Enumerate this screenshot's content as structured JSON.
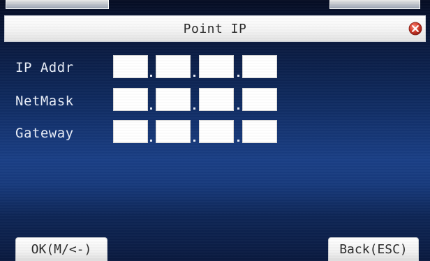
{
  "window": {
    "title": "Point IP",
    "close_icon": "close-icon",
    "accent_close": "#d23a2a"
  },
  "form": {
    "rows": [
      {
        "label": "IP Addr",
        "octets": [
          "",
          "",
          "",
          ""
        ]
      },
      {
        "label": "NetMask",
        "octets": [
          "",
          "",
          "",
          ""
        ]
      },
      {
        "label": "Gateway",
        "octets": [
          "",
          "",
          "",
          ""
        ]
      }
    ]
  },
  "softkeys": {
    "ok_label": "OK(M/<-)",
    "back_label": "Back(ESC)"
  },
  "colors": {
    "background_top": "#060d24",
    "background_mid": "#1a3f86",
    "label_text": "#e9eef8",
    "field_bg": "#ffffff"
  }
}
